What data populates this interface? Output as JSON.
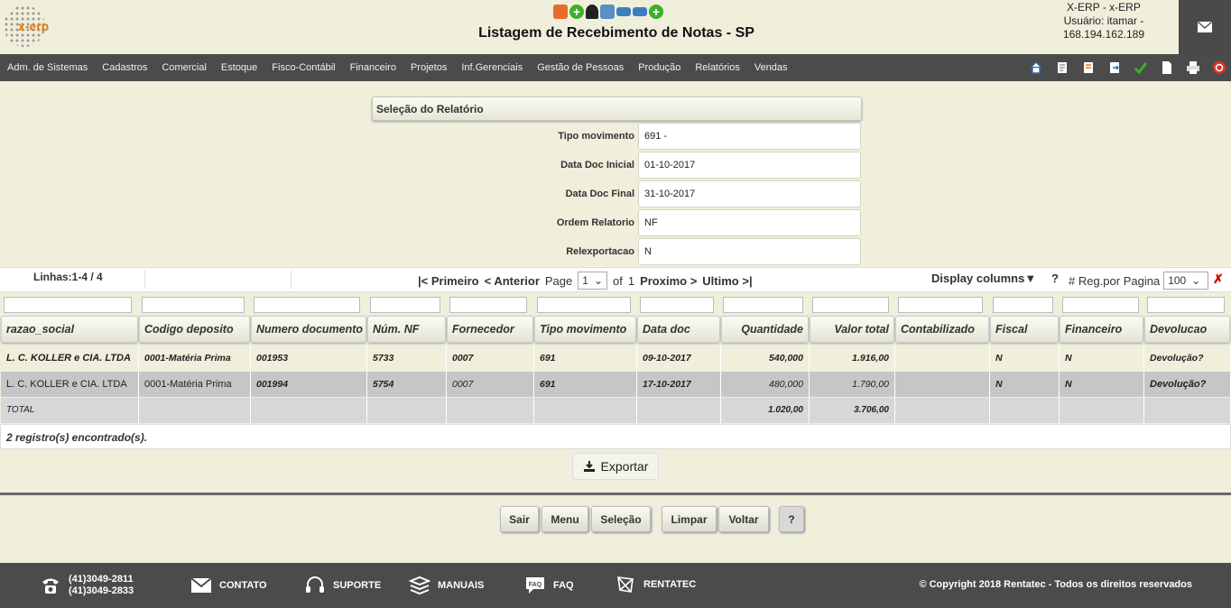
{
  "header": {
    "logo_text": "x-erp",
    "title": "Listagem de Recebimento de Notas - SP",
    "user_line1": "X-ERP - x-ERP",
    "user_line2": "Usuário: itamar -",
    "user_line3": "168.194.162.189"
  },
  "menu": {
    "items": [
      "Adm. de Sistemas",
      "Cadastros",
      "Comercial",
      "Estoque",
      "Fisco-Contábil",
      "Financeiro",
      "Projetos",
      "Inf.Gerenciais",
      "Gestão de Pessoas",
      "Produção",
      "Relatórios",
      "Vendas"
    ]
  },
  "selection": {
    "title": "Seleção do Relatório",
    "fields": [
      {
        "label": "Tipo movimento",
        "value": "691 -"
      },
      {
        "label": "Data Doc Inicial",
        "value": "01-10-2017"
      },
      {
        "label": "Data Doc Final",
        "value": "31-10-2017"
      },
      {
        "label": "Ordem Relatorio",
        "value": "NF"
      },
      {
        "label": "Relexportacao",
        "value": "N"
      }
    ]
  },
  "toolbar": {
    "linhas": "Linhas:1-4 / 4",
    "primeiro": "|< Primeiro",
    "anterior": "< Anterior",
    "page_label": "Page",
    "page_value": "1",
    "of_label": "of",
    "total_pages": "1",
    "proximo": "Proximo >",
    "ultimo": "Ultimo >|",
    "display_columns": "Display columns",
    "help": "?",
    "reg_por_pagina": "# Reg.por Pagina",
    "reg_value": "100"
  },
  "table": {
    "headers": [
      "razao_social",
      "Codigo deposito",
      "Numero documento",
      "Núm. NF",
      "Fornecedor",
      "Tipo movimento",
      "Data doc",
      "Quantidade",
      "Valor total",
      "Contabilizado",
      "Fiscal",
      "Financeiro",
      "Devolucao"
    ],
    "rows": [
      [
        "L. C. KOLLER e CIA. LTDA",
        "0001-Matéria Prima",
        "001953",
        "5733",
        "0007",
        "691",
        "09-10-2017",
        "540,000",
        "1.916,00",
        "",
        "N",
        "N",
        "Devolução?"
      ],
      [
        "L. C. KOLLER e CIA. LTDA",
        "0001-Matéria Prima",
        "001994",
        "5754",
        "0007",
        "691",
        "17-10-2017",
        "480,000",
        "1.790,00",
        "",
        "N",
        "N",
        "Devolução?"
      ]
    ],
    "total": [
      "TOTAL",
      "",
      "",
      "",
      "",
      "",
      "",
      "1.020,00",
      "3.706,00",
      "",
      "",
      "",
      ""
    ],
    "found": "2 registro(s) encontrado(s)."
  },
  "export_label": "Exportar",
  "buttons": {
    "sair": "Sair",
    "menu": "Menu",
    "selecao": "Seleção",
    "limpar": "Limpar",
    "voltar": "Voltar",
    "help": "?"
  },
  "footer": {
    "phone1": "(41)3049-2811",
    "phone2": "(41)3049-2833",
    "contato": "CONTATO",
    "suporte": "SUPORTE",
    "manuais": "MANUAIS",
    "faq": "FAQ",
    "rentatec": "RENTATEC",
    "copyright": "© Copyright 2018 Rentatec - Todos os direitos reservados"
  }
}
